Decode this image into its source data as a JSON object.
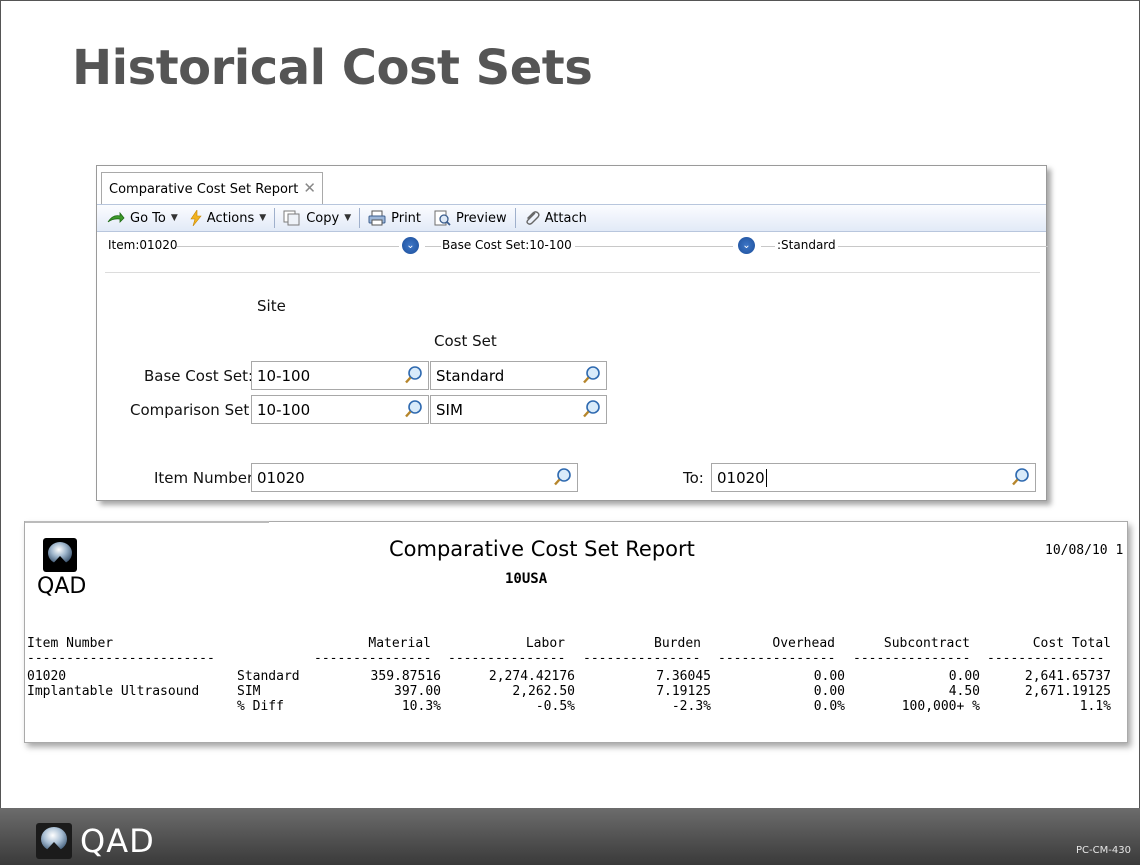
{
  "slide": {
    "title": "Historical Cost Sets",
    "footer_brand": "QAD",
    "footer_code": "PC-CM-430"
  },
  "app": {
    "tab_title": "Comparative Cost Set Report",
    "toolbar": {
      "goto": "Go To",
      "actions": "Actions",
      "copy": "Copy",
      "print": "Print",
      "preview": "Preview",
      "attach": "Attach"
    },
    "filter_bar": {
      "item": "Item:01020",
      "base_cost_set": "Base Cost Set:10-100",
      "standard": ":Standard"
    },
    "form": {
      "site_header": "Site",
      "cost_set_header": "Cost Set",
      "base_cost_set_label": "Base Cost Set:",
      "base_site_value": "10-100",
      "base_cost_set_value": "Standard",
      "comparison_set_label": "Comparison Set:",
      "comparison_site_value": "10-100",
      "comparison_cost_set_value": "SIM",
      "item_number_label": "Item Number:",
      "item_number_value": "01020",
      "to_label": "To:",
      "to_value": "01020"
    }
  },
  "report": {
    "logo_text": "QAD",
    "title": "Comparative Cost Set Report",
    "site": "10USA",
    "date": "10/08/10 1",
    "columns": [
      "Item Number",
      "Material",
      "Labor",
      "Burden",
      "Overhead",
      "Subcontract",
      "Cost Total"
    ],
    "item_number": "01020",
    "item_description": "Implantable Ultrasound",
    "rows": [
      {
        "label": "Standard",
        "material": "359.87516",
        "labor": "2,274.42176",
        "burden": "7.36045",
        "overhead": "0.00",
        "subcontract": "0.00",
        "total": "2,641.65737"
      },
      {
        "label": "SIM",
        "material": "397.00",
        "labor": "2,262.50",
        "burden": "7.19125",
        "overhead": "0.00",
        "subcontract": "4.50",
        "total": "2,671.19125"
      },
      {
        "label": "% Diff",
        "material": "10.3%",
        "labor": "-0.5%",
        "burden": "-2.3%",
        "overhead": "0.0%",
        "subcontract": "100,000+ %",
        "total": "1.1%"
      }
    ]
  },
  "colors": {
    "title_gray": "#555555",
    "toolbar_blue": "#e2eaf7",
    "footer_dark": "#3a3a3a"
  }
}
